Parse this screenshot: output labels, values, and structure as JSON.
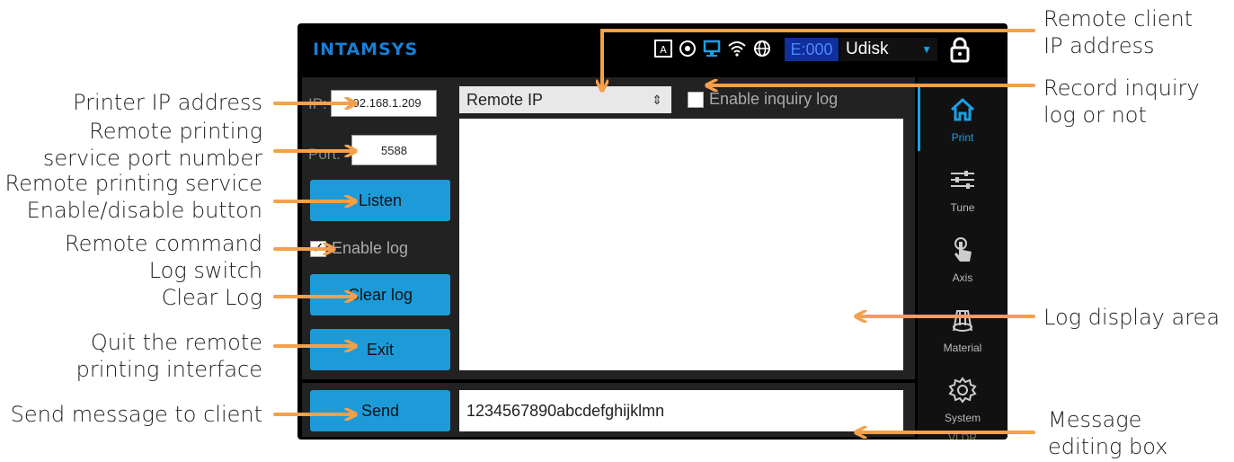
{
  "screen": {
    "logo": "INTAMSYS",
    "status_code": "E:000",
    "storage": "Udisk",
    "ip_label": "IP:",
    "ip_value": "192.168.1.209",
    "port_label": "Port:",
    "port_value": "5588",
    "remote_ip_select": "Remote IP",
    "inquiry_log_label": "Enable inquiry log",
    "listen_button": "Listen",
    "enable_log_label": "Enable log",
    "enable_log_checked": true,
    "clear_log_button": "Clear log",
    "exit_button": "Exit",
    "send_button": "Send",
    "message_value": "1234567890abcdefghijklmn",
    "sidebar": [
      {
        "label": "Print",
        "active": true
      },
      {
        "label": "Tune",
        "active": false
      },
      {
        "label": "Axis",
        "active": false
      },
      {
        "label": "Material",
        "active": false
      },
      {
        "label": "System",
        "active": false
      }
    ],
    "sidebar_partial_label": "VLDR"
  },
  "annotations": {
    "printer_ip": "Printer IP address",
    "port_1": "Remote printing",
    "port_2": "service port number",
    "listen_1": "Remote printing service",
    "listen_2": "Enable/disable button",
    "log_1": "Remote command",
    "log_2": "Log switch",
    "clear": "Clear Log",
    "quit_1": "Quit the remote",
    "quit_2": "printing interface",
    "send": "Send message to client",
    "remote_ip_1": "Remote client",
    "remote_ip_2": "IP address",
    "inquiry_1": "Record inquiry",
    "inquiry_2": "log or not",
    "log_area": "Log display area",
    "msg_1": "Message",
    "msg_2": "editing box"
  },
  "colors": {
    "accent": "#1d9bd9",
    "arrow": "#f5a04a",
    "screen_bg": "#000000",
    "status_bg": "#102f9a"
  }
}
